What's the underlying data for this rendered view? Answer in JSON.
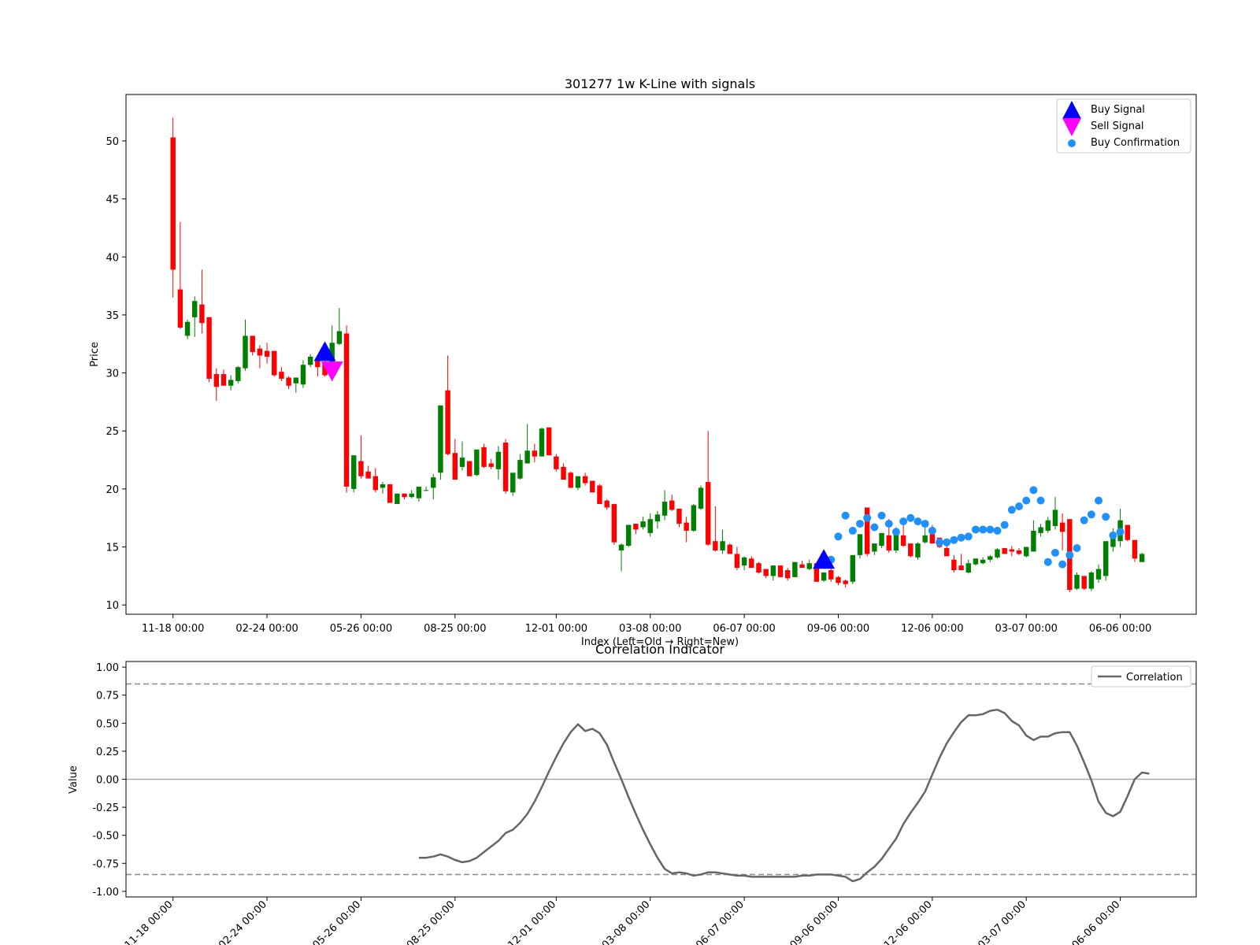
{
  "chart_data": [
    {
      "type": "candlestick",
      "title": "301277 1w K-Line with signals",
      "xlabel": "Index (Left=Old → Right=New)",
      "ylabel": "Price",
      "ylim": [
        9.2,
        54
      ],
      "yticks": [
        10,
        15,
        20,
        25,
        30,
        35,
        40,
        45,
        50
      ],
      "xlim": [
        -6.5,
        141.5
      ],
      "xticks": [
        {
          "index": 0,
          "label": "11-18 00:00"
        },
        {
          "index": 13,
          "label": "02-24 00:00"
        },
        {
          "index": 26,
          "label": "05-26 00:00"
        },
        {
          "index": 39,
          "label": "08-25 00:00"
        },
        {
          "index": 53,
          "label": "12-01 00:00"
        },
        {
          "index": 66,
          "label": "03-08 00:00"
        },
        {
          "index": 79,
          "label": "06-07 00:00"
        },
        {
          "index": 92,
          "label": "09-06 00:00"
        },
        {
          "index": 105,
          "label": "12-06 00:00"
        },
        {
          "index": 118,
          "label": "03-07 00:00"
        },
        {
          "index": 131,
          "label": "06-06 00:00"
        }
      ],
      "up_color": "#008000",
      "down_color": "#ff0000",
      "ohlc": [
        [
          50.3,
          52.0,
          36.5,
          38.9
        ],
        [
          37.2,
          43.0,
          33.8,
          33.9
        ],
        [
          33.2,
          34.6,
          32.9,
          34.4
        ],
        [
          34.8,
          36.6,
          33.1,
          36.2
        ],
        [
          35.9,
          38.9,
          33.4,
          34.3
        ],
        [
          34.8,
          34.8,
          29.2,
          29.5
        ],
        [
          29.9,
          30.4,
          27.6,
          28.8
        ],
        [
          29.9,
          30.3,
          28.9,
          28.9
        ],
        [
          28.9,
          29.8,
          28.5,
          29.4
        ],
        [
          29.3,
          30.6,
          29.1,
          30.5
        ],
        [
          30.4,
          34.6,
          30.2,
          33.2
        ],
        [
          33.2,
          33.2,
          31.5,
          31.8
        ],
        [
          32.1,
          32.4,
          30.4,
          31.5
        ],
        [
          31.9,
          32.6,
          30.8,
          31.4
        ],
        [
          31.9,
          31.9,
          29.7,
          29.8
        ],
        [
          30.1,
          30.5,
          29.3,
          29.5
        ],
        [
          29.6,
          29.7,
          28.6,
          28.9
        ],
        [
          29.1,
          29.6,
          28.3,
          29.6
        ],
        [
          29.0,
          31.1,
          28.7,
          30.7
        ],
        [
          30.7,
          31.6,
          30.5,
          31.4
        ],
        [
          31.1,
          31.3,
          29.7,
          30.5
        ],
        [
          30.9,
          32.1,
          29.7,
          29.8
        ],
        [
          30.6,
          34.1,
          29.3,
          32.6
        ],
        [
          32.5,
          35.6,
          32.4,
          33.6
        ],
        [
          33.4,
          34.1,
          19.7,
          20.2
        ],
        [
          20.0,
          22.8,
          19.7,
          22.9
        ],
        [
          22.4,
          24.6,
          20.9,
          21.1
        ],
        [
          21.5,
          22.0,
          20.9,
          20.9
        ],
        [
          21.1,
          21.8,
          19.7,
          19.9
        ],
        [
          20.1,
          20.6,
          19.6,
          20.4
        ],
        [
          20.4,
          20.4,
          18.8,
          18.8
        ],
        [
          18.7,
          19.6,
          18.7,
          19.6
        ],
        [
          19.6,
          19.6,
          19.1,
          19.3
        ],
        [
          19.3,
          19.9,
          19.2,
          19.6
        ],
        [
          19.2,
          20.2,
          18.9,
          20.2
        ],
        [
          19.9,
          20.2,
          19.8,
          19.9
        ],
        [
          20.1,
          21.3,
          19.1,
          21.0
        ],
        [
          21.4,
          27.2,
          20.8,
          27.2
        ],
        [
          28.5,
          31.5,
          22.9,
          23.0
        ],
        [
          23.1,
          24.3,
          20.8,
          20.8
        ],
        [
          21.9,
          24.1,
          21.6,
          22.7
        ],
        [
          22.4,
          22.4,
          21.1,
          21.1
        ],
        [
          21.2,
          23.4,
          21.1,
          23.4
        ],
        [
          23.6,
          23.9,
          21.8,
          21.9
        ],
        [
          22.2,
          22.6,
          21.7,
          21.9
        ],
        [
          21.7,
          23.7,
          20.8,
          23.2
        ],
        [
          24.0,
          24.3,
          19.6,
          19.8
        ],
        [
          19.7,
          21.3,
          19.4,
          21.4
        ],
        [
          20.9,
          23.0,
          20.8,
          22.5
        ],
        [
          22.2,
          25.6,
          22.2,
          23.3
        ],
        [
          23.3,
          23.9,
          22.3,
          22.8
        ],
        [
          22.8,
          25.3,
          22.8,
          25.2
        ],
        [
          25.3,
          25.3,
          22.9,
          22.9
        ],
        [
          22.8,
          23.0,
          21.5,
          21.7
        ],
        [
          21.9,
          22.2,
          20.8,
          20.8
        ],
        [
          21.4,
          21.5,
          20.1,
          20.1
        ],
        [
          20.1,
          21.1,
          19.9,
          21.1
        ],
        [
          21.1,
          21.4,
          20.3,
          20.5
        ],
        [
          20.7,
          20.7,
          19.7,
          19.7
        ],
        [
          20.3,
          20.4,
          18.7,
          18.7
        ],
        [
          19.0,
          19.1,
          18.2,
          18.4
        ],
        [
          18.7,
          18.7,
          15.2,
          15.4
        ],
        [
          14.7,
          15.3,
          12.9,
          15.2
        ],
        [
          15.1,
          16.9,
          15.0,
          16.9
        ],
        [
          17.0,
          17.0,
          16.1,
          16.5
        ],
        [
          16.7,
          17.6,
          16.5,
          17.2
        ],
        [
          16.2,
          17.9,
          15.9,
          17.4
        ],
        [
          17.2,
          18.1,
          16.6,
          17.8
        ],
        [
          17.7,
          19.9,
          17.3,
          18.9
        ],
        [
          19.0,
          19.5,
          18.1,
          18.2
        ],
        [
          18.3,
          18.3,
          16.7,
          17.0
        ],
        [
          17.1,
          17.6,
          15.4,
          16.4
        ],
        [
          16.4,
          18.7,
          16.3,
          18.6
        ],
        [
          18.3,
          20.3,
          18.2,
          20.1
        ],
        [
          20.6,
          25.0,
          15.1,
          15.2
        ],
        [
          15.5,
          18.5,
          14.6,
          14.7
        ],
        [
          14.7,
          16.5,
          14.4,
          15.5
        ],
        [
          15.2,
          15.3,
          14.4,
          14.4
        ],
        [
          14.4,
          15.0,
          13.0,
          13.2
        ],
        [
          13.4,
          14.2,
          13.0,
          14.1
        ],
        [
          14.0,
          14.2,
          13.2,
          13.2
        ],
        [
          13.6,
          13.7,
          12.7,
          12.8
        ],
        [
          13.1,
          13.1,
          12.3,
          12.5
        ],
        [
          12.5,
          13.4,
          12.1,
          13.4
        ],
        [
          13.4,
          13.4,
          12.4,
          12.4
        ],
        [
          13.0,
          13.2,
          12.1,
          12.3
        ],
        [
          12.4,
          13.7,
          12.4,
          13.7
        ],
        [
          13.5,
          13.8,
          13.2,
          13.2
        ],
        [
          13.1,
          13.9,
          13.0,
          13.6
        ],
        [
          13.6,
          13.6,
          12.0,
          12.0
        ],
        [
          12.1,
          12.8,
          12.0,
          12.8
        ],
        [
          13.0,
          13.1,
          12.0,
          12.2
        ],
        [
          12.4,
          12.5,
          11.7,
          11.9
        ],
        [
          12.1,
          12.2,
          11.5,
          11.8
        ],
        [
          12.0,
          14.3,
          11.8,
          14.3
        ],
        [
          14.3,
          16.1,
          14.0,
          16.1
        ],
        [
          18.4,
          18.4,
          14.2,
          14.4
        ],
        [
          14.6,
          15.2,
          14.3,
          15.3
        ],
        [
          15.1,
          16.2,
          14.9,
          16.2
        ],
        [
          16.0,
          17.4,
          14.5,
          14.7
        ],
        [
          14.7,
          16.7,
          14.5,
          16.3
        ],
        [
          16.0,
          17.0,
          15.0,
          15.1
        ],
        [
          15.3,
          15.3,
          14.1,
          14.2
        ],
        [
          14.1,
          15.4,
          13.9,
          15.3
        ],
        [
          15.4,
          16.7,
          15.3,
          16.0
        ],
        [
          16.1,
          16.9,
          15.3,
          15.3
        ],
        [
          15.8,
          15.8,
          14.9,
          15.0
        ],
        [
          14.9,
          15.3,
          14.2,
          14.2
        ],
        [
          13.9,
          14.3,
          12.8,
          13.0
        ],
        [
          13.4,
          14.4,
          13.1,
          13.0
        ],
        [
          12.8,
          13.9,
          12.7,
          13.6
        ],
        [
          13.5,
          14.0,
          13.4,
          14.0
        ],
        [
          13.6,
          14.1,
          13.5,
          13.9
        ],
        [
          13.9,
          14.3,
          13.7,
          14.2
        ],
        [
          14.1,
          14.9,
          14.0,
          14.8
        ],
        [
          14.9,
          14.9,
          14.4,
          14.4
        ],
        [
          14.8,
          15.1,
          14.2,
          14.6
        ],
        [
          14.7,
          14.9,
          14.3,
          14.4
        ],
        [
          14.2,
          15.0,
          14.1,
          15.0
        ],
        [
          14.6,
          17.3,
          14.6,
          16.4
        ],
        [
          16.2,
          17.0,
          15.9,
          16.7
        ],
        [
          16.4,
          17.6,
          16.2,
          17.3
        ],
        [
          16.8,
          19.3,
          16.5,
          18.2
        ],
        [
          17.1,
          17.9,
          14.7,
          16.3
        ],
        [
          17.4,
          17.4,
          11.1,
          11.3
        ],
        [
          11.4,
          12.8,
          11.3,
          12.6
        ],
        [
          12.5,
          12.5,
          11.3,
          11.4
        ],
        [
          11.4,
          12.9,
          11.2,
          12.8
        ],
        [
          12.2,
          13.5,
          11.9,
          13.1
        ],
        [
          12.5,
          15.3,
          12.1,
          15.5
        ],
        [
          15.0,
          16.6,
          14.6,
          15.9
        ],
        [
          15.5,
          18.3,
          15.0,
          17.3
        ],
        [
          16.9,
          16.9,
          15.5,
          15.6
        ],
        [
          15.6,
          15.6,
          13.7,
          14.0
        ],
        [
          13.7,
          14.5,
          13.7,
          14.4
        ]
      ],
      "buy_signals": [
        [
          21,
          31.7
        ],
        [
          90,
          13.8
        ]
      ],
      "sell_signals": [
        [
          22,
          30.3
        ]
      ],
      "buy_confirmations": [
        [
          91,
          13.9
        ],
        [
          92,
          15.9
        ],
        [
          93,
          17.7
        ],
        [
          94,
          16.4
        ],
        [
          95,
          17.0
        ],
        [
          96,
          17.5
        ],
        [
          97,
          16.7
        ],
        [
          98,
          17.7
        ],
        [
          99,
          17.0
        ],
        [
          100,
          16.3
        ],
        [
          101,
          17.2
        ],
        [
          102,
          17.5
        ],
        [
          103,
          17.2
        ],
        [
          104,
          17.0
        ],
        [
          105,
          16.4
        ],
        [
          106,
          15.4
        ],
        [
          107,
          15.4
        ],
        [
          108,
          15.6
        ],
        [
          109,
          15.8
        ],
        [
          110,
          15.9
        ],
        [
          111,
          16.5
        ],
        [
          112,
          16.5
        ],
        [
          113,
          16.5
        ],
        [
          114,
          16.4
        ],
        [
          115,
          16.9
        ],
        [
          116,
          18.2
        ],
        [
          117,
          18.5
        ],
        [
          118,
          19.0
        ],
        [
          119,
          19.9
        ],
        [
          120,
          19.0
        ],
        [
          121,
          13.7
        ],
        [
          122,
          14.5
        ],
        [
          123,
          13.5
        ],
        [
          124,
          14.3
        ],
        [
          125,
          14.9
        ],
        [
          126,
          17.3
        ],
        [
          127,
          17.8
        ],
        [
          128,
          19.0
        ],
        [
          129,
          17.6
        ],
        [
          130,
          16.0
        ],
        [
          131,
          16.3
        ]
      ],
      "buy_color": "#0000ff",
      "sell_color": "#ff00ff",
      "confirm_color": "#1e90ff",
      "legend": {
        "placement": "top-right",
        "entries": [
          "Buy Signal",
          "Sell Signal",
          "Buy Confirmation"
        ]
      }
    },
    {
      "type": "line",
      "title": "Correlation Indicator",
      "ylabel": "Value",
      "xlabel": "",
      "ylim": [
        -1.05,
        1.05
      ],
      "yticks": [
        1.0,
        0.75,
        0.5,
        0.25,
        0.0,
        -0.25,
        -0.5,
        -0.75,
        -1.0
      ],
      "xlim": [
        -6.5,
        141.5
      ],
      "xticks": [
        {
          "index": 0,
          "label": "11-18 00:00"
        },
        {
          "index": 13,
          "label": "02-24 00:00"
        },
        {
          "index": 26,
          "label": "05-26 00:00"
        },
        {
          "index": 39,
          "label": "08-25 00:00"
        },
        {
          "index": 53,
          "label": "12-01 00:00"
        },
        {
          "index": 66,
          "label": "03-08 00:00"
        },
        {
          "index": 79,
          "label": "06-07 00:00"
        },
        {
          "index": 92,
          "label": "09-06 00:00"
        },
        {
          "index": 105,
          "label": "12-06 00:00"
        },
        {
          "index": 118,
          "label": "03-07 00:00"
        },
        {
          "index": 131,
          "label": "06-06 00:00"
        }
      ],
      "hlines": [
        {
          "y": 0.85,
          "style": "dashed"
        },
        {
          "y": 0.0,
          "style": "solid"
        },
        {
          "y": -0.85,
          "style": "dashed"
        }
      ],
      "series": [
        {
          "name": "Correlation",
          "color": "#666666",
          "x_start": 34,
          "values": [
            -0.7,
            -0.7,
            -0.69,
            -0.67,
            -0.69,
            -0.72,
            -0.74,
            -0.73,
            -0.7,
            -0.65,
            -0.6,
            -0.55,
            -0.48,
            -0.45,
            -0.39,
            -0.31,
            -0.2,
            -0.07,
            0.07,
            0.2,
            0.32,
            0.42,
            0.49,
            0.43,
            0.45,
            0.41,
            0.31,
            0.15,
            0.0,
            -0.16,
            -0.31,
            -0.45,
            -0.58,
            -0.7,
            -0.8,
            -0.84,
            -0.83,
            -0.84,
            -0.86,
            -0.85,
            -0.83,
            -0.83,
            -0.84,
            -0.85,
            -0.86,
            -0.86,
            -0.87,
            -0.87,
            -0.87,
            -0.87,
            -0.87,
            -0.87,
            -0.87,
            -0.86,
            -0.86,
            -0.85,
            -0.85,
            -0.85,
            -0.86,
            -0.87,
            -0.91,
            -0.89,
            -0.83,
            -0.78,
            -0.71,
            -0.62,
            -0.53,
            -0.4,
            -0.3,
            -0.21,
            -0.11,
            0.04,
            0.19,
            0.32,
            0.42,
            0.51,
            0.57,
            0.57,
            0.58,
            0.61,
            0.62,
            0.59,
            0.52,
            0.48,
            0.39,
            0.35,
            0.38,
            0.38,
            0.41,
            0.42,
            0.42,
            0.3,
            0.15,
            -0.01,
            -0.2,
            -0.3,
            -0.33,
            -0.29,
            -0.15,
            0.0,
            0.06,
            0.05
          ]
        }
      ],
      "legend": {
        "placement": "top-right",
        "entries": [
          "Correlation"
        ]
      }
    }
  ]
}
